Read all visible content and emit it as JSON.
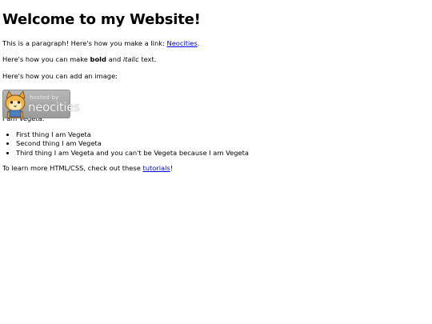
{
  "page": {
    "heading": "Welcome to my Website!",
    "para1": {
      "prefix": "This is a paragraph! Here's how you make a link: ",
      "link_text": "Neocities",
      "suffix": "."
    },
    "para2": {
      "prefix": "Here's how you can make ",
      "bold": "bold",
      "middle": " and ",
      "italic": "italic",
      "suffix": " text."
    },
    "para3": "Here's how you can add an image:",
    "badge": {
      "small_text": "hosted by",
      "large_text": "neocities",
      "icon": "neocities-cat-icon"
    },
    "para4": "I am Vegeta:",
    "list": [
      "First thing I am Vegeta",
      "Second thing I am Vegeta",
      "Third thing I am Vegeta and you can't be Vegeta because I am Vegeta"
    ],
    "para5": {
      "prefix": "To learn more HTML/CSS, check out these ",
      "link_text": "tutorials",
      "suffix": "!"
    }
  },
  "colors": {
    "link": "#0000ee",
    "text": "#000000",
    "background": "#ffffff"
  }
}
